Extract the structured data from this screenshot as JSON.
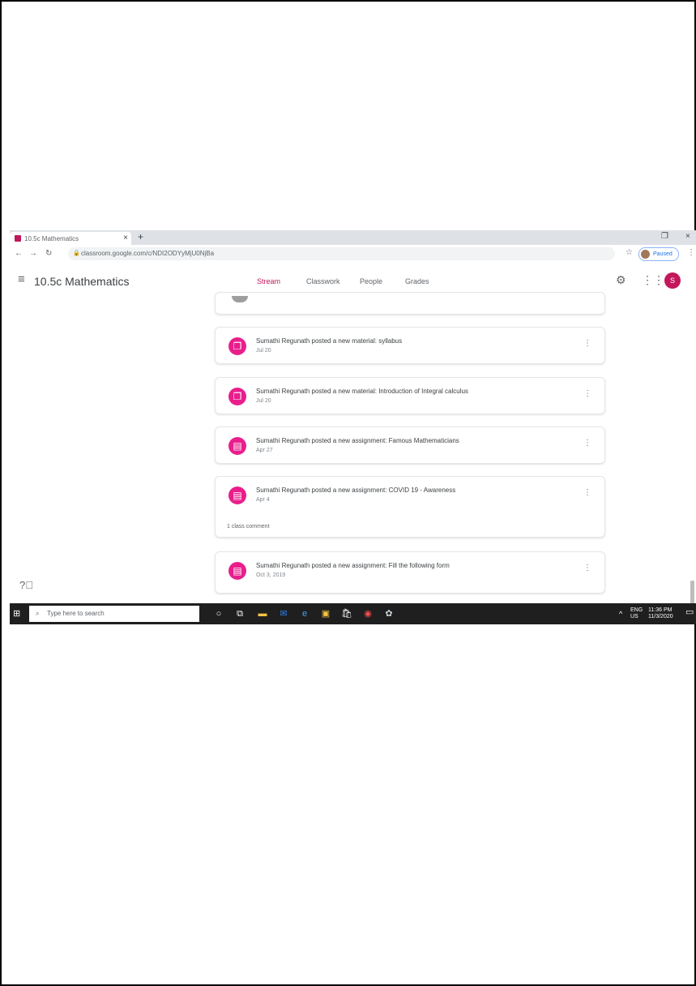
{
  "browser": {
    "tab_title": "10.5c Mathematics",
    "tab_close": "×",
    "new_tab": "+",
    "url": "classroom.google.com/c/NDI2ODYyMjU0NjBa",
    "profile_label": "Paused",
    "window_controls": [
      "❐",
      "×"
    ]
  },
  "classroom": {
    "title": "10.5c Mathematics",
    "tabs": [
      "Stream",
      "Classwork",
      "People",
      "Grades"
    ],
    "active_tab": "Stream",
    "user_initial": "S"
  },
  "stream": {
    "posts": [
      {
        "text": "Sumathi Regunath posted a new material: syllabus",
        "date": "Jul 20",
        "icon": "material-icon"
      },
      {
        "text": "Sumathi Regunath posted a new material: Introduction of Integral calculus",
        "date": "Jul 20",
        "icon": "material-icon"
      },
      {
        "text": "Sumathi Regunath posted a new assignment: Famous Mathematicians",
        "date": "Apr 27",
        "icon": "assignment-icon"
      },
      {
        "text": "Sumathi Regunath posted a new assignment: COVID 19 - Awareness",
        "date": "Apr 4",
        "icon": "assignment-icon",
        "comment": "1 class comment"
      },
      {
        "text": "Sumathi Regunath posted a new assignment: Fill the following form",
        "date": "Oct 3, 2019",
        "icon": "assignment-icon"
      }
    ]
  },
  "taskbar": {
    "search_placeholder": "Type here to search",
    "language": "ENG",
    "region": "US",
    "time": "11:36 PM",
    "date": "11/3/2020"
  }
}
